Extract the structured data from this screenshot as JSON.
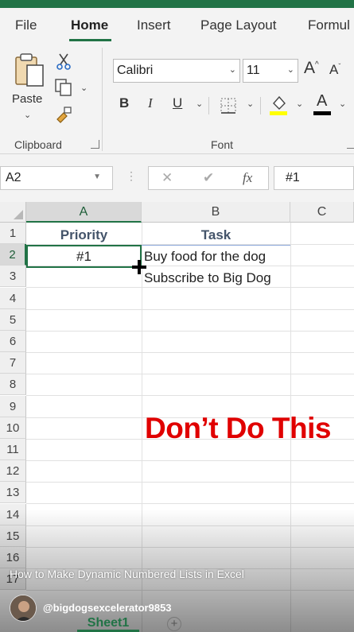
{
  "ribbon_tabs": {
    "file": "File",
    "home": "Home",
    "insert": "Insert",
    "page_layout": "Page Layout",
    "formulas": "Formul"
  },
  "clipboard": {
    "paste_label": "Paste",
    "group_label": "Clipboard"
  },
  "font": {
    "name": "Calibri",
    "size": "11",
    "group_label": "Font",
    "bold": "B",
    "italic": "I",
    "underline": "U",
    "grow": "A",
    "shrink": "A",
    "font_color": "A",
    "highlight_color": "#ffff00",
    "font_color_value": "#000000"
  },
  "formula_bar": {
    "name_box": "A2",
    "fx": "fx",
    "value": "#1"
  },
  "columns": [
    "A",
    "B",
    "C"
  ],
  "rows": [
    "1",
    "2",
    "3",
    "4",
    "5",
    "6",
    "7",
    "8",
    "9",
    "10",
    "11",
    "12",
    "13",
    "14",
    "15",
    "16",
    "17"
  ],
  "cells": {
    "a1": "Priority",
    "b1": "Task",
    "a2": "#1",
    "b2": "Buy food for the dog",
    "b3": "Subscribe to Big Dog"
  },
  "overlay_text": "Don’t Do This",
  "video": {
    "caption": "How to Make Dynamic Numbered Lists in Excel",
    "channel": "@bigdogsexcelerator9853"
  },
  "sheets": {
    "active": "Sheet1",
    "add": "+"
  },
  "colors": {
    "accent": "#217346",
    "header_text": "#44546a",
    "overlay": "#e00000"
  }
}
